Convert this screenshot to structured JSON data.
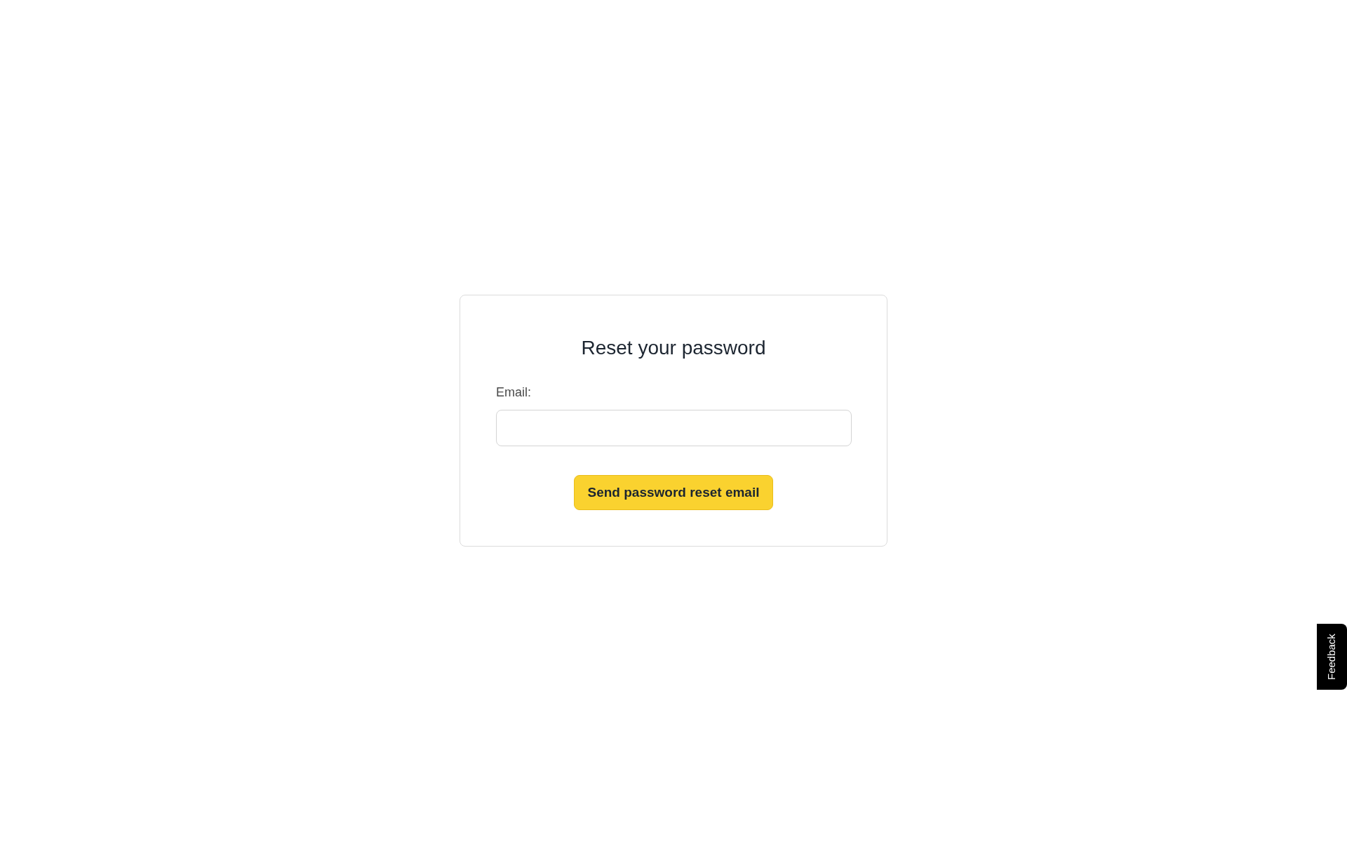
{
  "form": {
    "title": "Reset your password",
    "email_label": "Email:",
    "button": "Send password reset email"
  },
  "feedback_tab": {
    "label": "Feedback"
  }
}
